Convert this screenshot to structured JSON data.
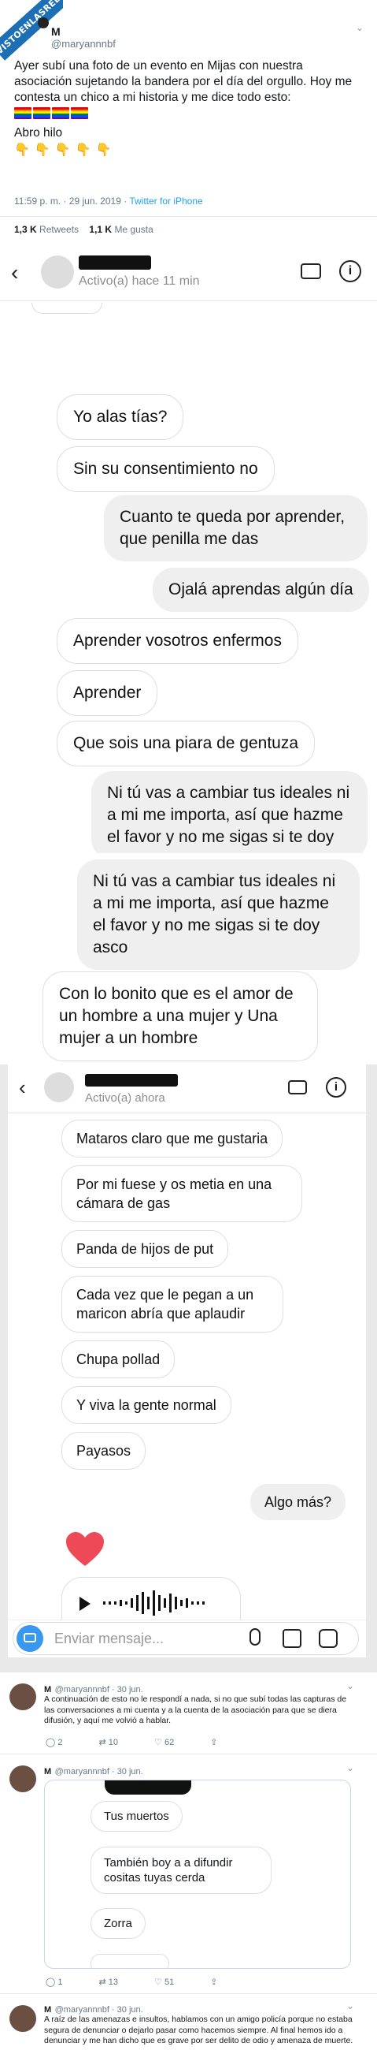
{
  "watermark": "VISTOENLASREDES.com",
  "tweet": {
    "name": "M",
    "handle": "@maryannnbf",
    "text": "Ayer subí una foto de un evento en Mijas con nuestra asociación sujetando la bandera por el día del orgullo. Hoy me contesta un chico a mi historia y me dice todo esto:",
    "abro": "Abro hilo",
    "time": "11:59 p. m. · 29 jun. 2019 ·",
    "source": "Twitter for iPhone",
    "retweets_num": "1,3 K",
    "retweets_label": "Retweets",
    "likes_num": "1,1 K",
    "likes_label": "Me gusta",
    "flag_colors": [
      "#e40303",
      "#ff8c00",
      "#ffed00",
      "#008026",
      "#004dff",
      "#750787"
    ]
  },
  "chat1": {
    "status": "Activo(a) hace 11 min",
    "messages": [
      {
        "dir": "in",
        "text": "Yo alas tías?"
      },
      {
        "dir": "in",
        "text": "Sin su consentimiento no"
      },
      {
        "dir": "out",
        "text": "Cuanto te queda por aprender, que penilla me das"
      },
      {
        "dir": "out",
        "text": "Ojalá aprendas algún día"
      },
      {
        "dir": "in",
        "text": "Aprender vosotros enfermos"
      },
      {
        "dir": "in",
        "text": "Aprender"
      },
      {
        "dir": "in",
        "text": "Que sois una piara de gentuza"
      },
      {
        "dir": "out",
        "text": "Ni tú vas a cambiar tus ideales ni a mi me importa, así que hazme el favor y no me sigas si te doy"
      }
    ]
  },
  "chat2": {
    "messages": [
      {
        "dir": "out",
        "text": "Ni tú vas a cambiar tus ideales ni a mi me importa, así que hazme el favor y no me sigas si te doy asco"
      },
      {
        "dir": "in",
        "text": "Con lo bonito que es el amor de un hombre a una mujer y Una mujer a un hombre"
      }
    ]
  },
  "chat3": {
    "status": "Activo(a) ahora",
    "messages": [
      {
        "dir": "in",
        "text": "Mataros claro que me gustaria"
      },
      {
        "dir": "in",
        "text": "Por mi fuese y os metia en una cámara de gas"
      },
      {
        "dir": "in",
        "text": "Panda de hijos de put"
      },
      {
        "dir": "in",
        "text": "Cada vez que le pegan a un maricon abría que aplaudir"
      },
      {
        "dir": "in",
        "text": "Chupa pollad"
      },
      {
        "dir": "in",
        "text": "Y viva la gente normal"
      },
      {
        "dir": "in",
        "text": "Payasos"
      },
      {
        "dir": "out",
        "text": "Algo más?"
      }
    ],
    "composer_placeholder": "Enviar mensaje..."
  },
  "reply1": {
    "name": "M",
    "handle": "@maryannnbf · 30 jun.",
    "text": "A continuación de esto no le respondí a nada, si no que subí todas las capturas de las conversaciones a mi cuenta y a la cuenta de la asociación para que se diera difusión, y aquí me volvió a hablar.",
    "replies": "2",
    "retweets": "10",
    "likes": "62"
  },
  "reply2": {
    "name": "M",
    "handle": "@maryannnbf · 30 jun.",
    "messages": [
      {
        "dir": "in",
        "text": "Tus muertos"
      },
      {
        "dir": "in",
        "text": "También boy a a difundir cositas tuyas cerda"
      },
      {
        "dir": "in",
        "text": "Zorra"
      }
    ],
    "replies": "1",
    "retweets": "13",
    "likes": "51"
  },
  "reply3": {
    "name": "M",
    "handle": "@maryannnbf · 30 jun.",
    "text": "A raíz de las amenazas e insultos, hablamos con un amigo policía porque no estaba segura de denunciar o dejarlo pasar como hacemos siempre. Al final hemos ido a denunciar y me han dicho que es grave por ser delito de odio y amenaza de muerte."
  }
}
